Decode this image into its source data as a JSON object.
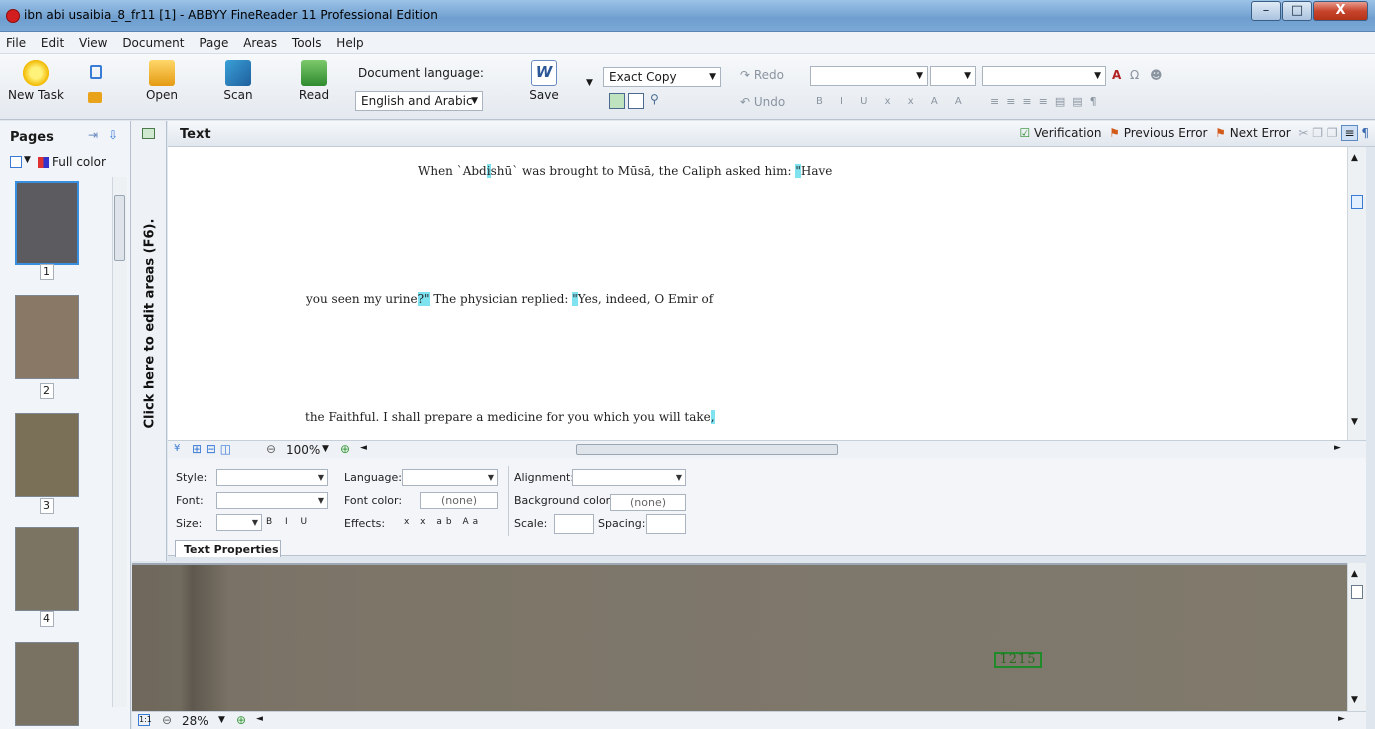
{
  "window": {
    "title": "ibn abi usaibia_8_fr11 [1] - ABBYY FineReader 11 Professional Edition",
    "controls": {
      "minimize": "–",
      "maximize": "□",
      "close": "X"
    }
  },
  "menu": [
    "File",
    "Edit",
    "View",
    "Document",
    "Page",
    "Areas",
    "Tools",
    "Help"
  ],
  "toolbar": {
    "new_task": "New Task",
    "open": "Open",
    "scan": "Scan",
    "read": "Read",
    "doc_lang_label": "Document language:",
    "doc_lang_value": "English and Arabic",
    "save": "Save",
    "mode_value": "Exact Copy",
    "redo": "Redo",
    "undo": "Undo"
  },
  "pages_pane": {
    "title": "Pages",
    "color_mode": "Full color",
    "pages": [
      "1",
      "2",
      "3",
      "4"
    ]
  },
  "side_strip": {
    "hint": "Click here to edit areas (F6)."
  },
  "text_panel": {
    "title": "Text",
    "verification": "Verification",
    "previous_error": "Previous Error",
    "next_error": "Next Error",
    "lines": [
      {
        "before": "When `Abd",
        "hl1": "i",
        "mid": "shū` was brought to Mūsā, the Caliph asked him: ",
        "hl2": "\"",
        "after": "Have"
      },
      {
        "before": "you seen my urine",
        "hl1": "?\"",
        "mid": " The physician replied: ",
        "hl2": "\"",
        "after": "Yes, indeed, O Emir of"
      },
      {
        "before": "the Faithful. I shall prepare a medicine for you which you will take",
        "hl1": ",",
        "mid": "",
        "hl2": "",
        "after": ""
      }
    ],
    "zoom": "100%"
  },
  "properties": {
    "style_label": "Style:",
    "font_label": "Font:",
    "size_label": "Size:",
    "language_label": "Language:",
    "font_color_label": "Font color:",
    "font_color_value": "(none)",
    "effects_label": "Effects:",
    "alignment_label": "Alignment:",
    "background_color_label": "Background color:",
    "background_color_value": "(none)",
    "scale_label": "Scale:",
    "spacing_label": "Spacing:",
    "tab": "Text Properties"
  },
  "image_panel": {
    "zoom": "28%",
    "page_number_text": "1215"
  },
  "colors": {
    "highlight": "#7fe3ef",
    "area_border": "#1f8a2a"
  }
}
